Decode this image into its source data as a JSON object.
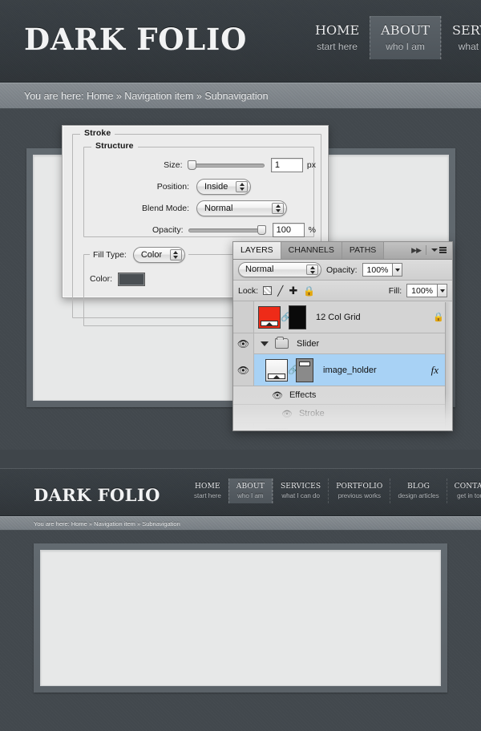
{
  "site": {
    "logo": "DARK FOLIO",
    "breadcrumb": "You are here: Home » Navigation item » Subnavigation",
    "top_nav": [
      {
        "title": "HOME",
        "subtitle": "start here",
        "active": false
      },
      {
        "title": "ABOUT",
        "subtitle": "who I am",
        "active": true
      },
      {
        "title": "SERVICES",
        "subtitle": "what I can do",
        "active": false
      }
    ],
    "mini_nav": [
      {
        "title": "HOME",
        "subtitle": "start here",
        "active": false
      },
      {
        "title": "ABOUT",
        "subtitle": "who I am",
        "active": true
      },
      {
        "title": "SERVICES",
        "subtitle": "what I can do",
        "active": false
      },
      {
        "title": "PORTFOLIO",
        "subtitle": "previous works",
        "active": false
      },
      {
        "title": "BLOG",
        "subtitle": "design articles",
        "active": false
      },
      {
        "title": "CONTACT",
        "subtitle": "get in touch",
        "active": false
      }
    ]
  },
  "stroke_dialog": {
    "legend_stroke": "Stroke",
    "legend_structure": "Structure",
    "size_label": "Size:",
    "size_value": "1",
    "size_unit": "px",
    "position_label": "Position:",
    "position_value": "Inside",
    "blend_mode_label": "Blend Mode:",
    "blend_mode_value": "Normal",
    "opacity_label": "Opacity:",
    "opacity_value": "100",
    "opacity_unit": "%",
    "fill_type_label": "Fill Type:",
    "fill_type_value": "Color",
    "color_label": "Color:",
    "color_swatch": "#4a4f53"
  },
  "layers_panel": {
    "tabs": [
      {
        "label": "LAYERS",
        "active": true
      },
      {
        "label": "CHANNELS",
        "active": false
      },
      {
        "label": "PATHS",
        "active": false
      }
    ],
    "blend_mode": "Normal",
    "opacity_label": "Opacity:",
    "opacity_value": "100%",
    "lock_label": "Lock:",
    "fill_label": "Fill:",
    "fill_value": "100%",
    "selection_color": "#a8d2f5",
    "rows": [
      {
        "name": "12 Col Grid",
        "visible": false,
        "locked": true,
        "thumb": "#ee2b18",
        "mask": "#0a0a0a"
      },
      {
        "name": "Slider",
        "visible": true,
        "type": "group"
      },
      {
        "name": "image_holder",
        "visible": true,
        "selected": true,
        "fx": "fx",
        "thumb": "#f0f0f0",
        "mask": "#8a8a8a"
      },
      {
        "name": "Effects",
        "visible": true,
        "type": "effects"
      },
      {
        "name": "Stroke",
        "visible": true,
        "type": "effect-item"
      }
    ]
  }
}
